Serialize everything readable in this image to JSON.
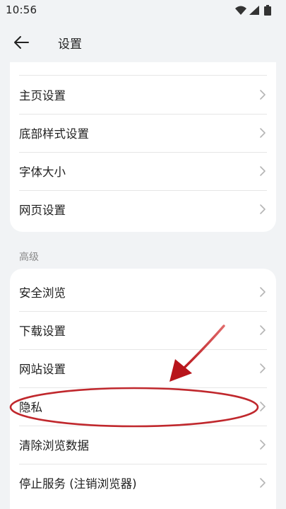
{
  "status_bar": {
    "time": "10:56"
  },
  "app_bar": {
    "back_icon": "arrow-left-icon",
    "title": "设置"
  },
  "settings_group": {
    "items": [
      {
        "label": "主页设置"
      },
      {
        "label": "底部样式设置"
      },
      {
        "label": "字体大小"
      },
      {
        "label": "网页设置"
      }
    ]
  },
  "advanced_group": {
    "header": "高级",
    "items": [
      {
        "label": "安全浏览"
      },
      {
        "label": "下载设置"
      },
      {
        "label": "网站设置"
      },
      {
        "label": "隐私"
      },
      {
        "label": "清除浏览数据"
      },
      {
        "label": "停止服务 (注销浏览器)"
      }
    ]
  },
  "annotation": {
    "color": "#c0282d",
    "highlighted_item": "隐私"
  },
  "colors": {
    "background": "#f1f3f5",
    "card": "#ffffff",
    "text": "#1f1f1f",
    "secondary_text": "#8a8a8a",
    "chevron": "#b5b5b5"
  }
}
